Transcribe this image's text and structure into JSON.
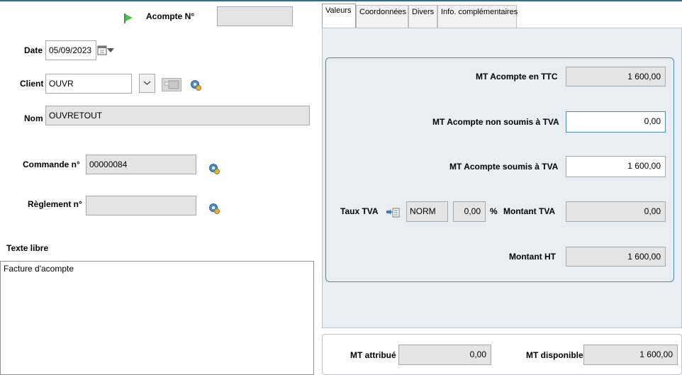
{
  "header": {
    "acompte_label": "Acompte N°",
    "acompte_value": ""
  },
  "left": {
    "date_label": "Date",
    "date_value": "05/09/2023",
    "client_label": "Client",
    "client_value": "OUVR",
    "nom_label": "Nom",
    "nom_value": "OUVRETOUT",
    "commande_label": "Commande n°",
    "commande_value": "00000084",
    "reglement_label": "Règlement n°",
    "reglement_value": "",
    "texte_label": "Texte libre",
    "texte_value": "Facture d'acompte"
  },
  "tabs": [
    {
      "label": "Valeurs"
    },
    {
      "label": "Coordonnées"
    },
    {
      "label": "Divers"
    },
    {
      "label": "Info. complémentaires"
    }
  ],
  "valeurs": {
    "ttc_label": "MT Acompte en TTC",
    "ttc_value": "1 600,00",
    "non_soumis_label": "MT Acompte non soumis à TVA",
    "non_soumis_value": "0,00",
    "soumis_label": "MT Acompte soumis à TVA",
    "soumis_value": "1 600,00",
    "taux_label": "Taux TVA",
    "taux_code": "NORM",
    "taux_value": "0,00",
    "pct": "%",
    "montant_tva_label": "Montant TVA",
    "montant_tva_value": "0,00",
    "montant_ht_label": "Montant HT",
    "montant_ht_value": "1 600,00"
  },
  "totaux": {
    "attribue_label": "MT attribué",
    "attribue_value": "0,00",
    "disponible_label": "MT disponible",
    "disponible_value": "1 600,00"
  },
  "colors": {
    "accent": "#2e6e8e",
    "field_bg": "#e4e4e4",
    "panel_bg": "#e9eef2"
  }
}
